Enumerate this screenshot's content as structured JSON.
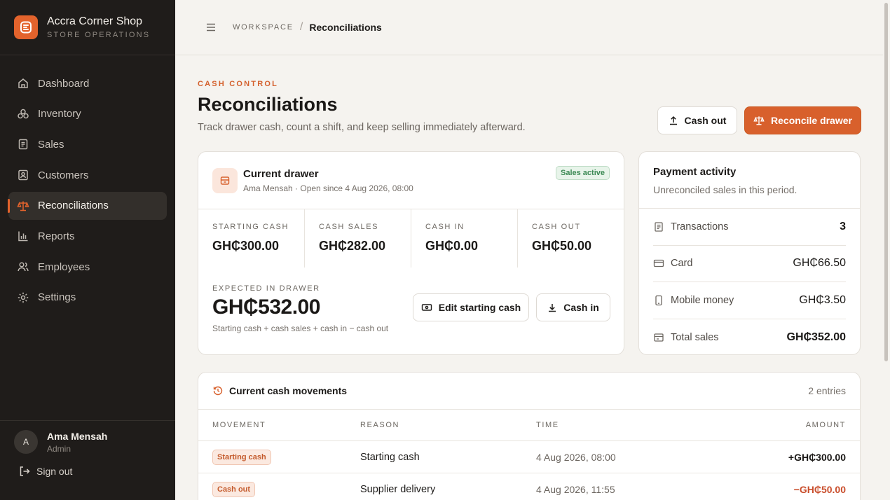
{
  "brand": {
    "name": "Accra Corner Shop",
    "subtitle": "STORE OPERATIONS"
  },
  "nav": [
    {
      "label": "Dashboard",
      "icon": "home-icon"
    },
    {
      "label": "Inventory",
      "icon": "boxes-icon"
    },
    {
      "label": "Sales",
      "icon": "receipt-icon"
    },
    {
      "label": "Customers",
      "icon": "contact-icon"
    },
    {
      "label": "Reconciliations",
      "icon": "scale-icon",
      "active": true
    },
    {
      "label": "Reports",
      "icon": "bar-chart-icon"
    },
    {
      "label": "Employees",
      "icon": "users-icon"
    },
    {
      "label": "Settings",
      "icon": "gear-icon"
    }
  ],
  "user": {
    "initial": "A",
    "name": "Ama Mensah",
    "role": "Admin",
    "signout": "Sign out"
  },
  "breadcrumb": {
    "workspace": "WORKSPACE",
    "separator": "/",
    "current": "Reconciliations"
  },
  "page": {
    "eyebrow": "CASH CONTROL",
    "title": "Reconciliations",
    "subtitle": "Track drawer cash, count a shift, and keep selling immediately afterward."
  },
  "actions": {
    "cash_out": "Cash out",
    "reconcile": "Reconcile drawer"
  },
  "drawer": {
    "title": "Current drawer",
    "meta": "Ama Mensah · Open since 4 Aug 2026, 08:00",
    "badge": "Sales active",
    "stats": [
      {
        "label": "STARTING CASH",
        "value": "GH₵300.00"
      },
      {
        "label": "CASH SALES",
        "value": "GH₵282.00"
      },
      {
        "label": "CASH IN",
        "value": "GH₵0.00"
      },
      {
        "label": "CASH OUT",
        "value": "GH₵50.00"
      }
    ],
    "expected_label": "EXPECTED IN DRAWER",
    "expected_value": "GH₵532.00",
    "formula": "Starting cash + cash sales + cash in − cash out",
    "edit_button": "Edit starting cash",
    "cash_in_button": "Cash in"
  },
  "payment": {
    "title": "Payment activity",
    "subtitle": "Unreconciled sales in this period.",
    "rows": [
      {
        "label": "Transactions",
        "value": "3",
        "icon": "receipt-icon"
      },
      {
        "label": "Card",
        "value": "GH₵66.50",
        "icon": "card-icon"
      },
      {
        "label": "Mobile money",
        "value": "GH₵3.50",
        "icon": "phone-icon"
      },
      {
        "label": "Total sales",
        "value": "GH₵352.00",
        "icon": "wallet-icon"
      }
    ]
  },
  "movements": {
    "title": "Current cash movements",
    "count": "2 entries",
    "headers": {
      "movement": "MOVEMENT",
      "reason": "REASON",
      "time": "TIME",
      "amount": "AMOUNT"
    },
    "rows": [
      {
        "type": "Starting cash",
        "reason": "Starting cash",
        "time": "4 Aug 2026, 08:00",
        "amount": "+GH₵300.00"
      },
      {
        "type": "Cash out",
        "reason": "Supplier delivery",
        "time": "4 Aug 2026, 11:55",
        "amount": "−GH₵50.00"
      }
    ]
  },
  "colors": {
    "accent": "#d8602c",
    "sidebar": "#1f1c1a",
    "background": "#f5f3ef",
    "positive_badge": "#3d8a55",
    "negative_amount": "#c94d2b"
  }
}
